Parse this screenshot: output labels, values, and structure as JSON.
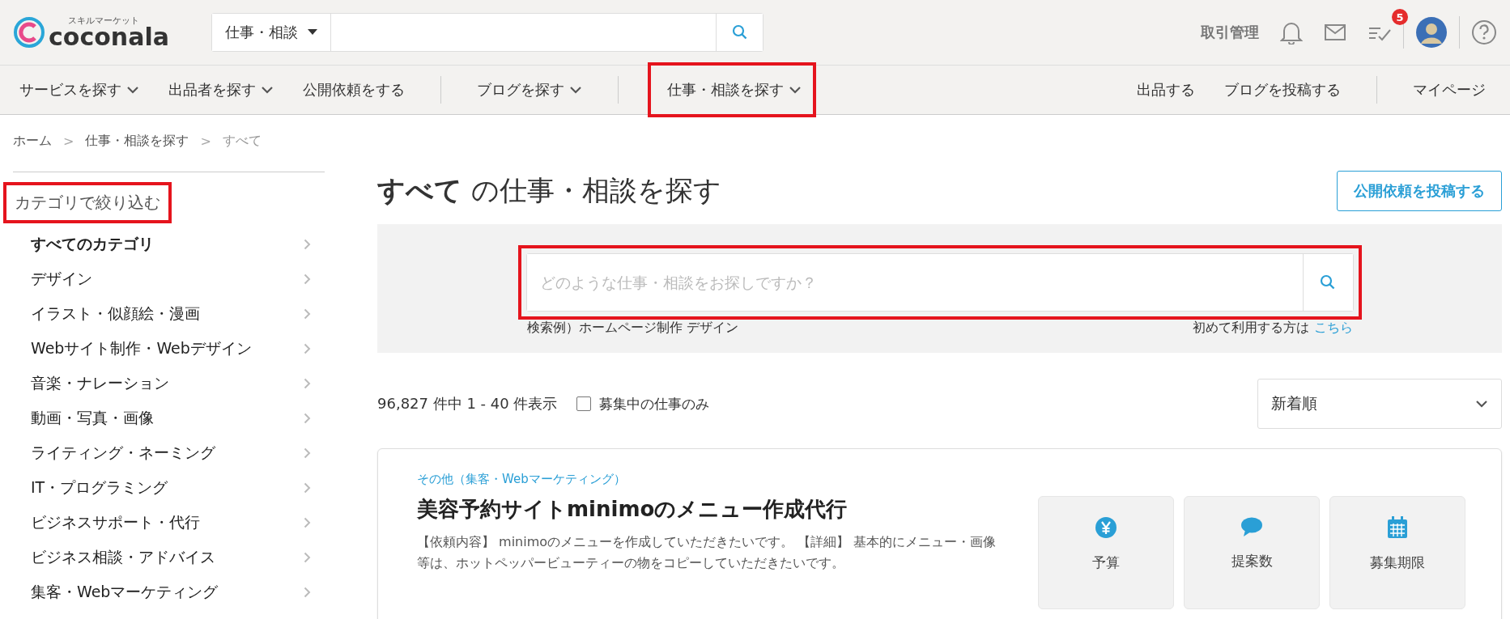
{
  "header": {
    "logo_tagline": "スキルマーケット",
    "logo_text": "coconala",
    "search_category": "仕事・相談",
    "trade_link": "取引管理",
    "todo_badge": "5"
  },
  "nav": {
    "left_groups": [
      [
        {
          "label": "サービスを探す",
          "dropdown": true,
          "highlighted": false
        },
        {
          "label": "出品者を探す",
          "dropdown": true,
          "highlighted": false
        },
        {
          "label": "公開依頼をする",
          "dropdown": false,
          "highlighted": false
        }
      ],
      [
        {
          "label": "ブログを探す",
          "dropdown": true,
          "highlighted": false
        }
      ],
      [
        {
          "label": "仕事・相談を探す",
          "dropdown": true,
          "highlighted": true
        }
      ]
    ],
    "right_groups": [
      [
        {
          "label": "出品する"
        },
        {
          "label": "ブログを投稿する"
        }
      ],
      [
        {
          "label": "マイページ"
        }
      ]
    ]
  },
  "breadcrumb": [
    {
      "label": "ホーム",
      "separator": ">",
      "current": false
    },
    {
      "label": "仕事・相談を探す",
      "separator": ">",
      "current": false
    },
    {
      "label": "すべて",
      "current": true
    }
  ],
  "sidebar": {
    "heading": "カテゴリで絞り込む",
    "heading_highlighted": true,
    "categories": [
      {
        "label": "すべてのカテゴリ",
        "selected": true
      },
      {
        "label": "デザイン",
        "selected": false
      },
      {
        "label": "イラスト・似顔絵・漫画",
        "selected": false
      },
      {
        "label": "Webサイト制作・Webデザイン",
        "selected": false
      },
      {
        "label": "音楽・ナレーション",
        "selected": false
      },
      {
        "label": "動画・写真・画像",
        "selected": false
      },
      {
        "label": "ライティング・ネーミング",
        "selected": false
      },
      {
        "label": "IT・プログラミング",
        "selected": false
      },
      {
        "label": "ビジネスサポート・代行",
        "selected": false
      },
      {
        "label": "ビジネス相談・アドバイス",
        "selected": false
      },
      {
        "label": "集客・Webマーケティング",
        "selected": false
      }
    ]
  },
  "main": {
    "title_bold": "すべて",
    "title_rest": "の仕事・相談を探す",
    "post_button": "公開依頼を投稿する",
    "search": {
      "placeholder": "どのような仕事・相談をお探しですか？",
      "highlighted": true,
      "example": "検索例）ホームページ制作 デザイン",
      "help_text": "初めて利用する方は",
      "help_link": "こちら"
    },
    "result_count": "96,827 件中 1 - 40 件表示",
    "filter": {
      "label": "募集中の仕事のみ",
      "checked": false
    },
    "sort": "新着順"
  },
  "card": {
    "category": "その他（集客・Webマーケティング）",
    "title": "美容予約サイトminimoのメニュー作成代行",
    "description": "【依頼内容】 minimoのメニューを作成していただきたいです。 【詳細】 基本的にメニュー・画像等は、ホットペッパービューティーの物をコピーしていただきたいです。",
    "stats": [
      {
        "kind": "yen",
        "label": "予算"
      },
      {
        "kind": "comment",
        "label": "提案数"
      },
      {
        "kind": "calendar",
        "label": "募集期限"
      }
    ]
  }
}
